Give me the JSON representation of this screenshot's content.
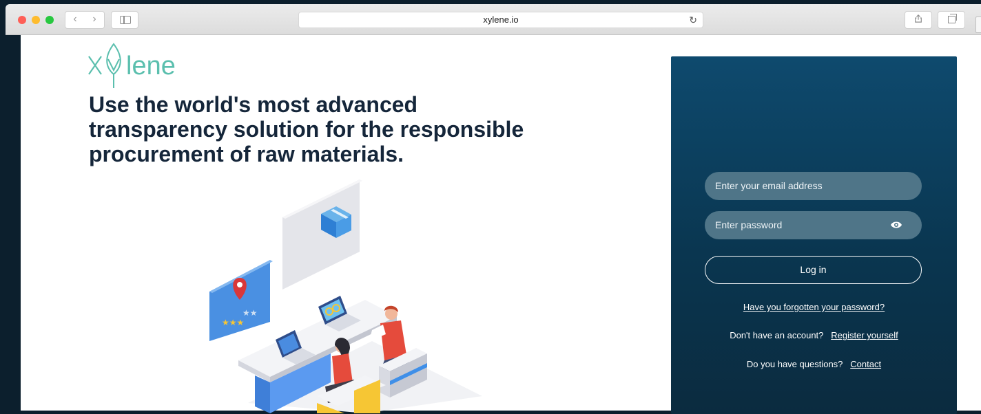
{
  "browser": {
    "url": "xylene.io",
    "back_glyph": "‹",
    "forward_glyph": "›",
    "reload_glyph": "↻",
    "icons": [
      "back-icon",
      "forward-icon",
      "sidebar-icon",
      "reload-icon",
      "share-icon",
      "tabs-icon"
    ]
  },
  "brand": {
    "logo_text": "Xylene",
    "logo_color": "#5bbfae"
  },
  "hero": {
    "headline_line1": "Use the world's most advanced",
    "headline_line2": "transparency solution for the responsible",
    "headline_line3": "procurement of raw materials."
  },
  "login": {
    "email_placeholder": "Enter your email address",
    "password_placeholder": "Enter password",
    "login_label": "Log in",
    "forgot_label": "Have you forgotten your password?",
    "no_account_text": "Don't have an account?",
    "register_label": "Register yourself",
    "questions_text": "Do you have questions?",
    "contact_label": "Contact",
    "panel_color": "#0b3a57",
    "field_color": "#4f7588"
  }
}
